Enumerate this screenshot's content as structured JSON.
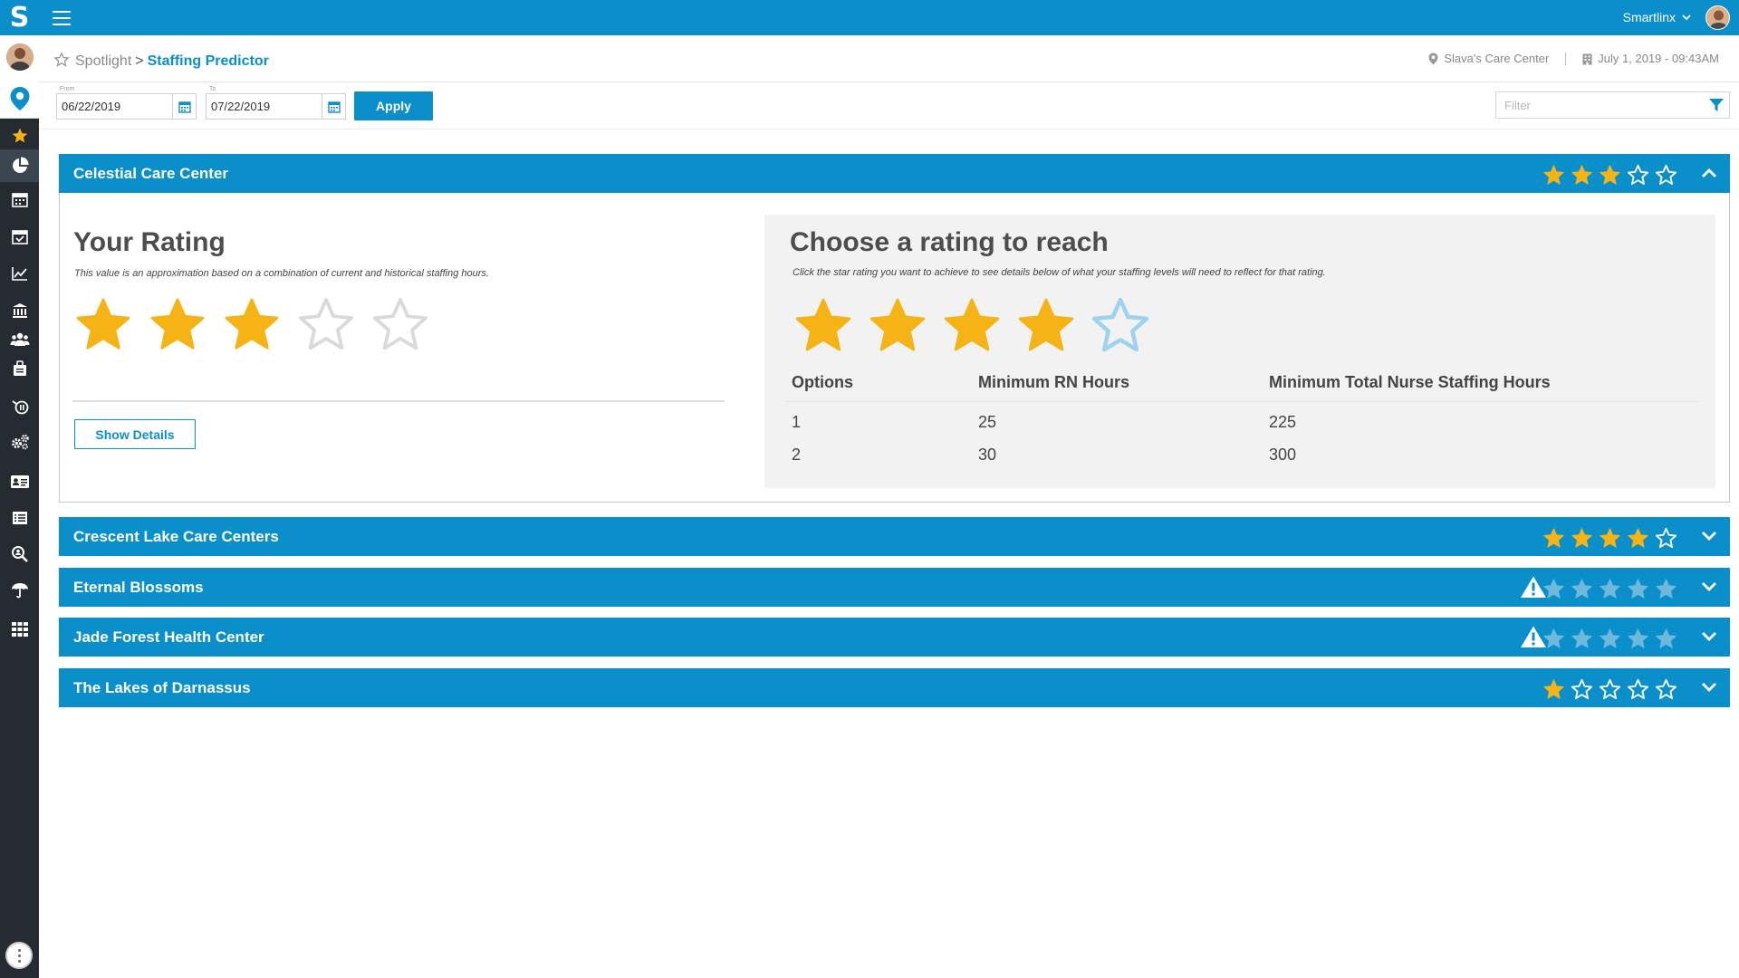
{
  "topbar": {
    "user_name": "Smartlinx"
  },
  "breadcrumb": {
    "parent": "Spotlight",
    "separator": ">",
    "current": "Staffing Predictor"
  },
  "header_info": {
    "location": "Slava's Care Center",
    "datetime": "July 1, 2019 - 09:43AM"
  },
  "dates": {
    "from_label": "From",
    "from_value": "06/22/2019",
    "to_label": "To",
    "to_value": "07/22/2019",
    "apply_label": "Apply"
  },
  "filter": {
    "placeholder": "Filter"
  },
  "colors": {
    "brand": "#0a8fcb",
    "star_filled": "#f5b315",
    "sidebar": "#262b31"
  },
  "facilities": [
    {
      "name": "Celestial Care Center",
      "rating": 3,
      "expanded": true,
      "warning": false
    },
    {
      "name": "Crescent Lake Care Centers",
      "rating": 4,
      "expanded": false,
      "warning": false
    },
    {
      "name": "Eternal Blossoms",
      "rating": 0,
      "expanded": false,
      "warning": true
    },
    {
      "name": "Jade Forest Health Center",
      "rating": 0,
      "expanded": false,
      "warning": true
    },
    {
      "name": "The Lakes of Darnassus",
      "rating": 1,
      "expanded": false,
      "warning": false
    }
  ],
  "your_rating": {
    "title": "Your Rating",
    "subtitle": "This value is an approximation based on a combination of current and historical staffing hours.",
    "rating": 3,
    "show_details_label": "Show Details"
  },
  "choose_rating": {
    "title": "Choose a rating to reach",
    "subtitle": "Click the star rating you want to achieve to see details below of what your staffing levels will need to reflect for that rating.",
    "selected": 4,
    "columns": [
      "Options",
      "Minimum RN Hours",
      "Minimum Total Nurse Staffing Hours"
    ],
    "rows": [
      [
        "1",
        "25",
        "225"
      ],
      [
        "2",
        "30",
        "300"
      ]
    ]
  }
}
